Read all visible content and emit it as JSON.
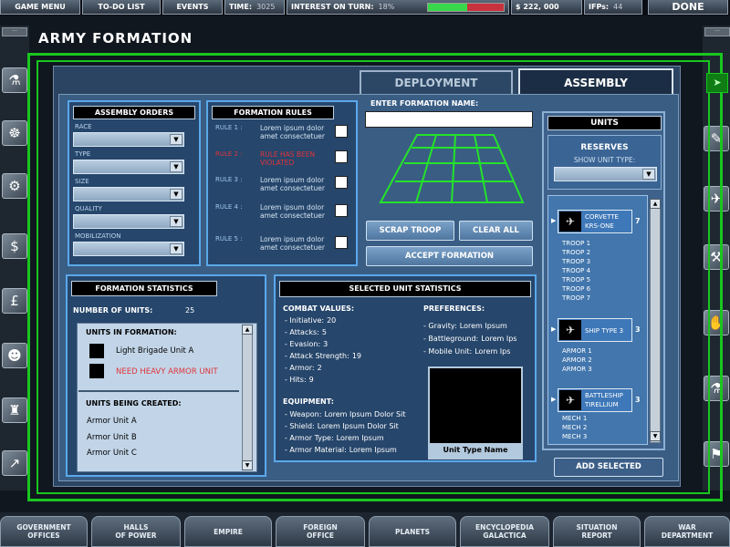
{
  "topbar": {
    "game_menu": "GAME MENU",
    "todo_list": "TO-DO LIST",
    "events": "EVENTS",
    "time_label": "TIME:",
    "time_value": "3025",
    "interest_label": "INTEREST ON TURN:",
    "interest_value": "18%",
    "interest_fraction": 0.52,
    "money": "$ 222, 000",
    "ifps_label": "IFPs:",
    "ifps_value": "44",
    "done": "DONE"
  },
  "page_title": "ARMY FORMATION",
  "tabs": {
    "deployment": "DEPLOYMENT",
    "assembly": "ASSEMBLY"
  },
  "assembly_orders": {
    "title": "ASSEMBLY ORDERS",
    "fields": [
      {
        "label": "RACE",
        "value": ""
      },
      {
        "label": "TYPE",
        "value": ""
      },
      {
        "label": "SIZE",
        "value": ""
      },
      {
        "label": "QUALITY",
        "value": ""
      },
      {
        "label": "MOBILIZATION",
        "value": ""
      }
    ]
  },
  "formation_rules": {
    "title": "FORMATION RULES",
    "rules": [
      {
        "label": "RULE 1 :",
        "text": "Lorem ipsum dolor amet consectetuer",
        "violated": false
      },
      {
        "label": "RULE 2 :",
        "text": "RULE HAS BEEN VIOLATED",
        "violated": true
      },
      {
        "label": "RULE 3 :",
        "text": "Lorem ipsum dolor amet consectetuer",
        "violated": false
      },
      {
        "label": "RULE 4 :",
        "text": "Lorem ipsum dolor amet consectetuer",
        "violated": false
      },
      {
        "label": "RULE 5 :",
        "text": "Lorem ipsum dolor amet consectetuer",
        "violated": false
      }
    ]
  },
  "formation_name": {
    "label": "ENTER FORMATION NAME:",
    "value": ""
  },
  "buttons": {
    "scrap_troop": "SCRAP TROOP",
    "clear_all": "CLEAR ALL",
    "accept_formation": "ACCEPT FORMATION",
    "add_selected": "ADD SELECTED"
  },
  "units_panel": {
    "title": "UNITS",
    "reserves_label": "RESERVES",
    "show_type_label": "SHOW UNIT TYPE:",
    "show_type_value": "",
    "groups": [
      {
        "name": "CORVETTE KRS-ONE",
        "count": "7",
        "items": [
          "TROOP 1",
          "TROOP 2",
          "TROOP 3",
          "TROOP 4",
          "TROOP 5",
          "TROOP 6",
          "TROOP 7"
        ]
      },
      {
        "name": "SHIP TYPE 3",
        "count": "3",
        "items": [
          "ARMOR 1",
          "ARMOR 2",
          "ARMOR 3"
        ]
      },
      {
        "name": "BATTLESHIP TIRELLIUM",
        "count": "3",
        "items": [
          "MECH 1",
          "MECH 2",
          "MECH 3"
        ]
      }
    ]
  },
  "formation_stats": {
    "title": "FORMATION STATISTICS",
    "num_units_label": "NUMBER OF UNITS:",
    "num_units_value": "25",
    "in_formation_header": "UNITS IN FORMATION:",
    "in_formation": [
      {
        "text": "Light Brigade Unit A",
        "warning": false
      },
      {
        "text": "NEED HEAVY ARMOR UNIT",
        "warning": true
      }
    ],
    "being_created_header": "UNITS BEING CREATED:",
    "being_created": [
      "Armor Unit A",
      "Armor Unit B",
      "Armor Unit C"
    ]
  },
  "selected_unit_stats": {
    "title": "SELECTED UNIT STATISTICS",
    "combat_header": "COMBAT VALUES:",
    "combat": [
      {
        "label": "- Initiative:",
        "value": "20"
      },
      {
        "label": "- Attacks:",
        "value": "5"
      },
      {
        "label": "- Evasion:",
        "value": "3"
      },
      {
        "label": "- Attack Strength:",
        "value": "19"
      },
      {
        "label": "- Armor:",
        "value": "2"
      },
      {
        "label": "- Hits:",
        "value": "9"
      }
    ],
    "equipment_header": "EQUIPMENT:",
    "equipment": [
      {
        "label": "- Weapon:",
        "value": "Lorem Ipsum Dolor Sit"
      },
      {
        "label": "- Shield:",
        "value": "Lorem Ipsum Dolor Sit"
      },
      {
        "label": "- Armor Type:",
        "value": "Lorem Ipsum"
      },
      {
        "label": "- Armor Material:",
        "value": "Lorem Ipsum"
      }
    ],
    "preferences_header": "PREFERENCES:",
    "preferences": [
      {
        "label": "- Gravity:",
        "value": "Lorem Ipsum"
      },
      {
        "label": "- Battleground:",
        "value": "Lorem Ips"
      },
      {
        "label": "- Mobile Unit:",
        "value": "Lorem Ips"
      }
    ],
    "unit_type_name": "Unit Type Name"
  },
  "left_rail": {
    "icons": [
      "flask-icon",
      "brain-icon",
      "gears-icon",
      "dollar-icon",
      "pound-icon",
      "people-icon",
      "factory-icon",
      "chart-icon"
    ]
  },
  "right_rail": {
    "icons": [
      "wrench-icon",
      "jet-icon",
      "tools-icon",
      "hand-icon",
      "flask-tube-icon",
      "flag-icon",
      "pistol-icon"
    ]
  },
  "bottom_nav": [
    "GOVERNMENT\nOFFICES",
    "HALLS\nOF POWER",
    "EMPIRE",
    "FOREIGN\nOFFICE",
    "PLANETS",
    "ENCYCLOPEDIA\nGALACTICA",
    "SITUATION\nREPORT",
    "WAR\nDEPARTMENT"
  ],
  "colors": {
    "accent_green": "#19c61f",
    "panel_blue": "#26466b",
    "border_blue": "#5aa8ea",
    "warning_red": "#e0343b"
  }
}
